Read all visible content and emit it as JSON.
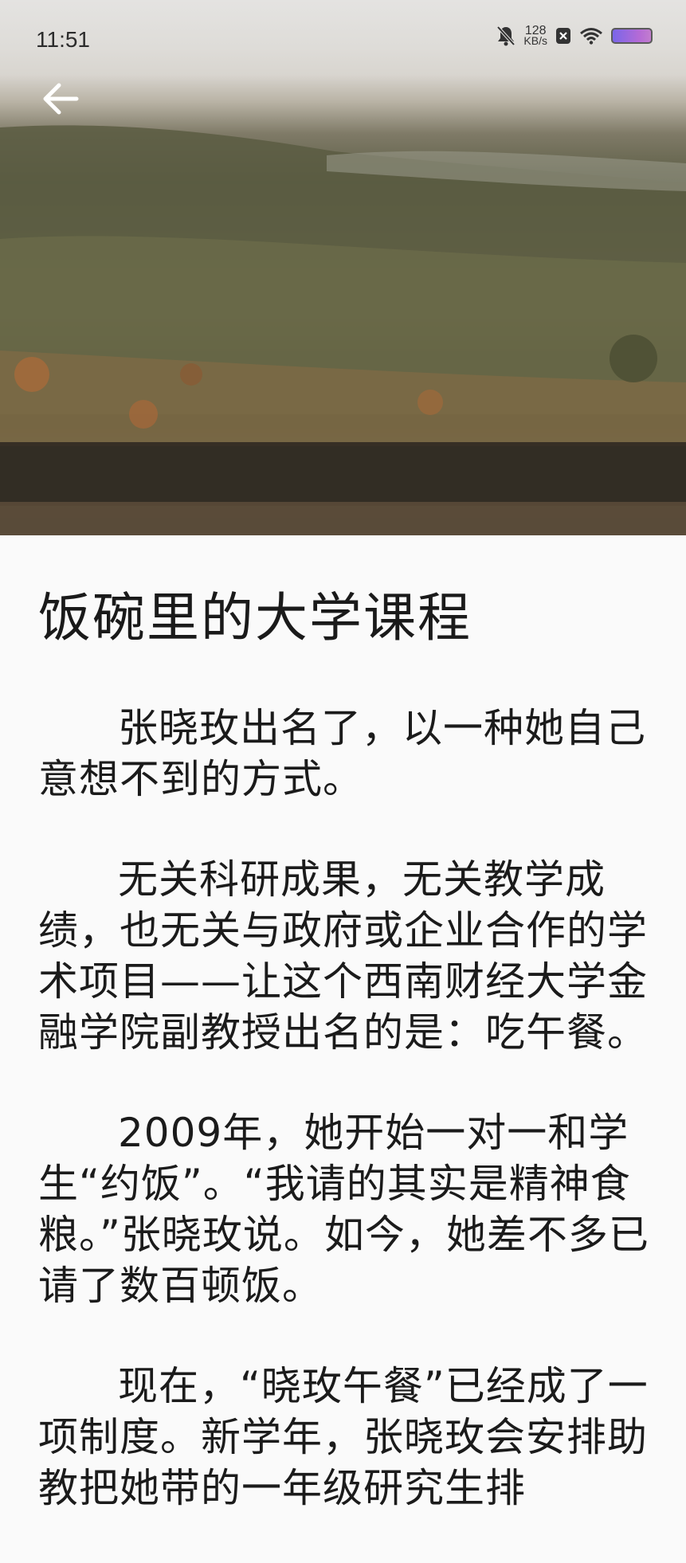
{
  "status_bar": {
    "time": "11:51",
    "net_speed_value": "128",
    "net_speed_unit": "KB/s",
    "icons": [
      "mute-bell-icon",
      "close-box-icon",
      "wifi-icon",
      "battery-icon"
    ]
  },
  "toolbar": {
    "back_icon": "back-arrow-icon"
  },
  "article": {
    "title": "饭碗里的大学课程",
    "paragraphs": [
      "张晓玫出名了，以一种她自己意想不到的方式。",
      "无关科研成果，无关教学成绩，也无关与政府或企业合作的学术项目——让这个西南财经大学金融学院副教授出名的是：吃午餐。",
      "2009年，她开始一对一和学生“约饭”。“我请的其实是精神食粮。”张晓玫说。如今，她差不多已请了数百顿饭。",
      "现在，“晓玫午餐”已经成了一项制度。新学年，张晓玫会安排助教把她带的一年级研究生排"
    ]
  },
  "colors": {
    "background": "#fafafa",
    "text": "#1b1b1b",
    "battery": "#9a6be0"
  }
}
